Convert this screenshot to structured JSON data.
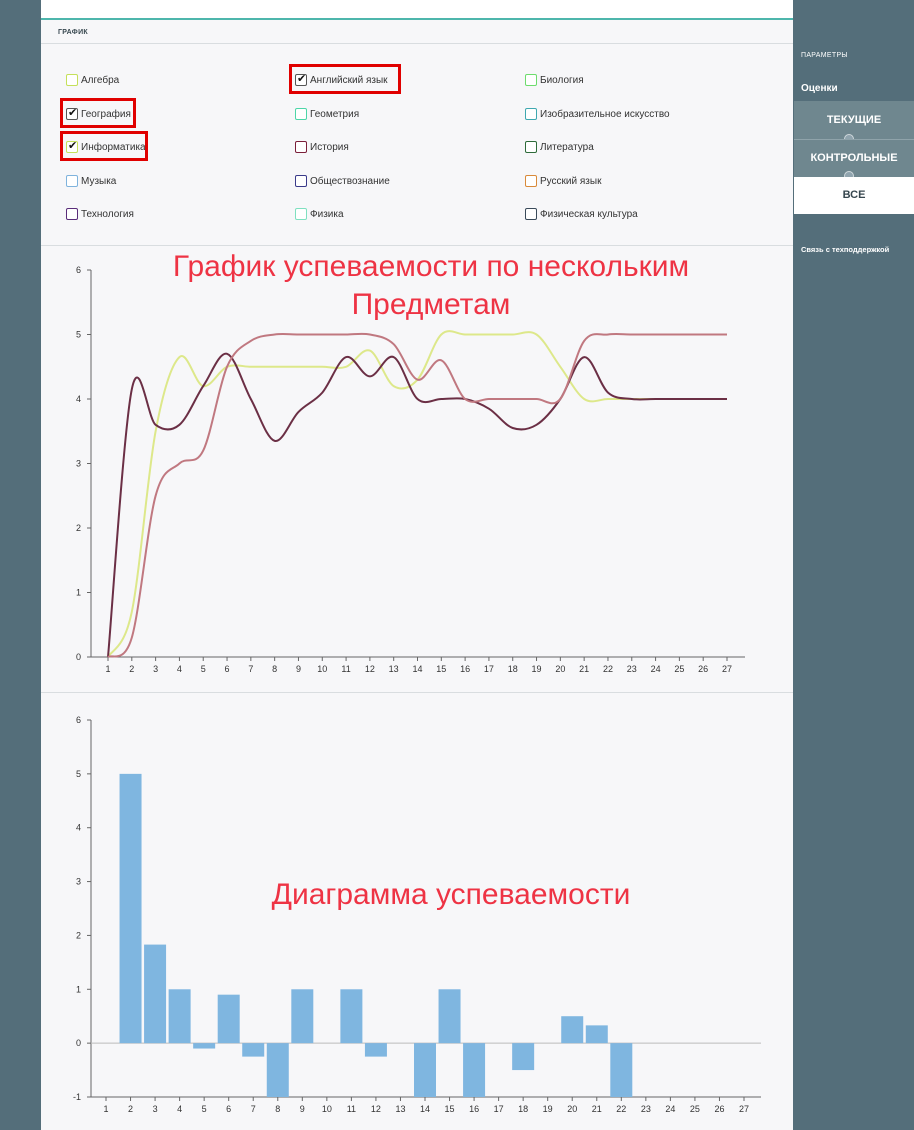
{
  "section_title": "ГРАФИК",
  "subjects": [
    {
      "label": "Алгебра",
      "color": "#c5e05a",
      "checked": false
    },
    {
      "label": "Английский язык",
      "color": "#555555",
      "checked": true
    },
    {
      "label": "Биология",
      "color": "#6ddc6d",
      "checked": false
    },
    {
      "label": "География",
      "color": "#555555",
      "checked": true
    },
    {
      "label": "Геометрия",
      "color": "#4dd6a8",
      "checked": false
    },
    {
      "label": "Изобразительное искусство",
      "color": "#3fa8b0",
      "checked": false
    },
    {
      "label": "Информатика",
      "color": "#c5e05a",
      "checked": true
    },
    {
      "label": "История",
      "color": "#7b1f3a",
      "checked": false
    },
    {
      "label": "Литература",
      "color": "#2e6b3a",
      "checked": false
    },
    {
      "label": "Музыка",
      "color": "#7fb3dd",
      "checked": false
    },
    {
      "label": "Обществознание",
      "color": "#3a3a8a",
      "checked": false
    },
    {
      "label": "Русский язык",
      "color": "#d98a3a",
      "checked": false
    },
    {
      "label": "Технология",
      "color": "#5a2d7a",
      "checked": false
    },
    {
      "label": "Физика",
      "color": "#7fe0c0",
      "checked": false
    },
    {
      "label": "Физическая культура",
      "color": "#3a4a5a",
      "checked": false
    }
  ],
  "overlays": {
    "line_title_1": "График успеваемости по нескольким",
    "line_title_2": "Предметам",
    "bar_title": "Диаграмма успеваемости"
  },
  "sidebar": {
    "params_label": "ПАРАМЕТРЫ",
    "grades_label": "Оценки",
    "buttons": [
      "ТЕКУЩИЕ",
      "КОНТРОЛЬНЫЕ",
      "ВСЕ"
    ],
    "active_button": "ВСЕ",
    "support_link": "Связь с техподдержкой"
  },
  "chart_data": [
    {
      "type": "line",
      "x": [
        1,
        2,
        3,
        4,
        5,
        6,
        7,
        8,
        9,
        10,
        11,
        12,
        13,
        14,
        15,
        16,
        17,
        18,
        19,
        20,
        21,
        22,
        23,
        24,
        25,
        26,
        27
      ],
      "ylim": [
        0,
        6
      ],
      "yticks": [
        0,
        1,
        2,
        3,
        4,
        5,
        6
      ],
      "series": [
        {
          "color": "#dde88a",
          "values": [
            0,
            0.7,
            3.5,
            4.65,
            4.2,
            4.5,
            4.5,
            4.5,
            4.5,
            4.5,
            4.5,
            4.75,
            4.2,
            4.3,
            5,
            5,
            5,
            5,
            5,
            4.5,
            4,
            4,
            4,
            4,
            4,
            4,
            4
          ]
        },
        {
          "color": "#6b2f45",
          "values": [
            0,
            4.15,
            3.6,
            3.6,
            4.2,
            4.7,
            4,
            3.35,
            3.8,
            4.1,
            4.65,
            4.35,
            4.65,
            4,
            4,
            4,
            3.85,
            3.55,
            3.6,
            4,
            4.65,
            4.1,
            4,
            4,
            4,
            4,
            4
          ]
        },
        {
          "color": "#c07880",
          "values": [
            0,
            0.3,
            2.5,
            3,
            3.2,
            4.5,
            4.9,
            5,
            5,
            5,
            5,
            5,
            4.85,
            4.3,
            4.6,
            4,
            4,
            4,
            4,
            4,
            4.9,
            5,
            5,
            5,
            5,
            5,
            5
          ]
        }
      ]
    },
    {
      "type": "bar",
      "categories": [
        "1",
        "2",
        "3",
        "4",
        "5",
        "6",
        "7",
        "8",
        "9",
        "10",
        "11",
        "12",
        "13",
        "14",
        "15",
        "16",
        "17",
        "18",
        "19",
        "20",
        "21",
        "22",
        "23",
        "24",
        "25",
        "26",
        "27"
      ],
      "values": [
        0,
        5,
        1.83,
        1,
        -0.1,
        0.9,
        -0.25,
        -1,
        1,
        0,
        1,
        -0.25,
        0,
        -1,
        1,
        -1,
        0,
        -0.5,
        0,
        0.5,
        0.33,
        -1,
        0,
        0,
        0,
        0,
        0
      ],
      "ylim": [
        -1,
        6
      ],
      "yticks": [
        -1,
        0,
        1,
        2,
        3,
        4,
        5,
        6
      ],
      "color": "#7fb6e0"
    }
  ]
}
